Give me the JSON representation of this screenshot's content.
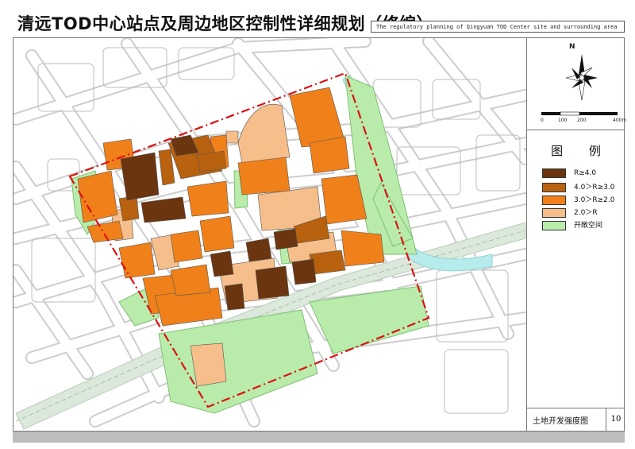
{
  "title": {
    "chinese": "清远TOD中心站点及周边地区控制性详细规划（修编）",
    "english": "The regulatory planning of Qingyuan TOD Center site and surrounding area"
  },
  "north_arrow": {
    "label": "N"
  },
  "scale_bar": {
    "ticks": [
      "0",
      "100",
      "200",
      "400m"
    ]
  },
  "legend": {
    "title": "图  例",
    "items": [
      {
        "label": "R≥4.0",
        "color": "#6b3510"
      },
      {
        "label": "4.0＞R≥3.0",
        "color": "#b8610f"
      },
      {
        "label": "3.0＞R≥2.0",
        "color": "#f08019"
      },
      {
        "label": "2.0＞R",
        "color": "#f5be8a"
      },
      {
        "label": "开敞空间",
        "color": "#b9ecab"
      }
    ]
  },
  "sheet": {
    "name": "土地开发强度图",
    "number": "10"
  },
  "colors": {
    "road_casing": "#c9c9c9",
    "boundary": "#dd1111",
    "water": "#b7ecec",
    "rail": "#cfe3cf"
  }
}
